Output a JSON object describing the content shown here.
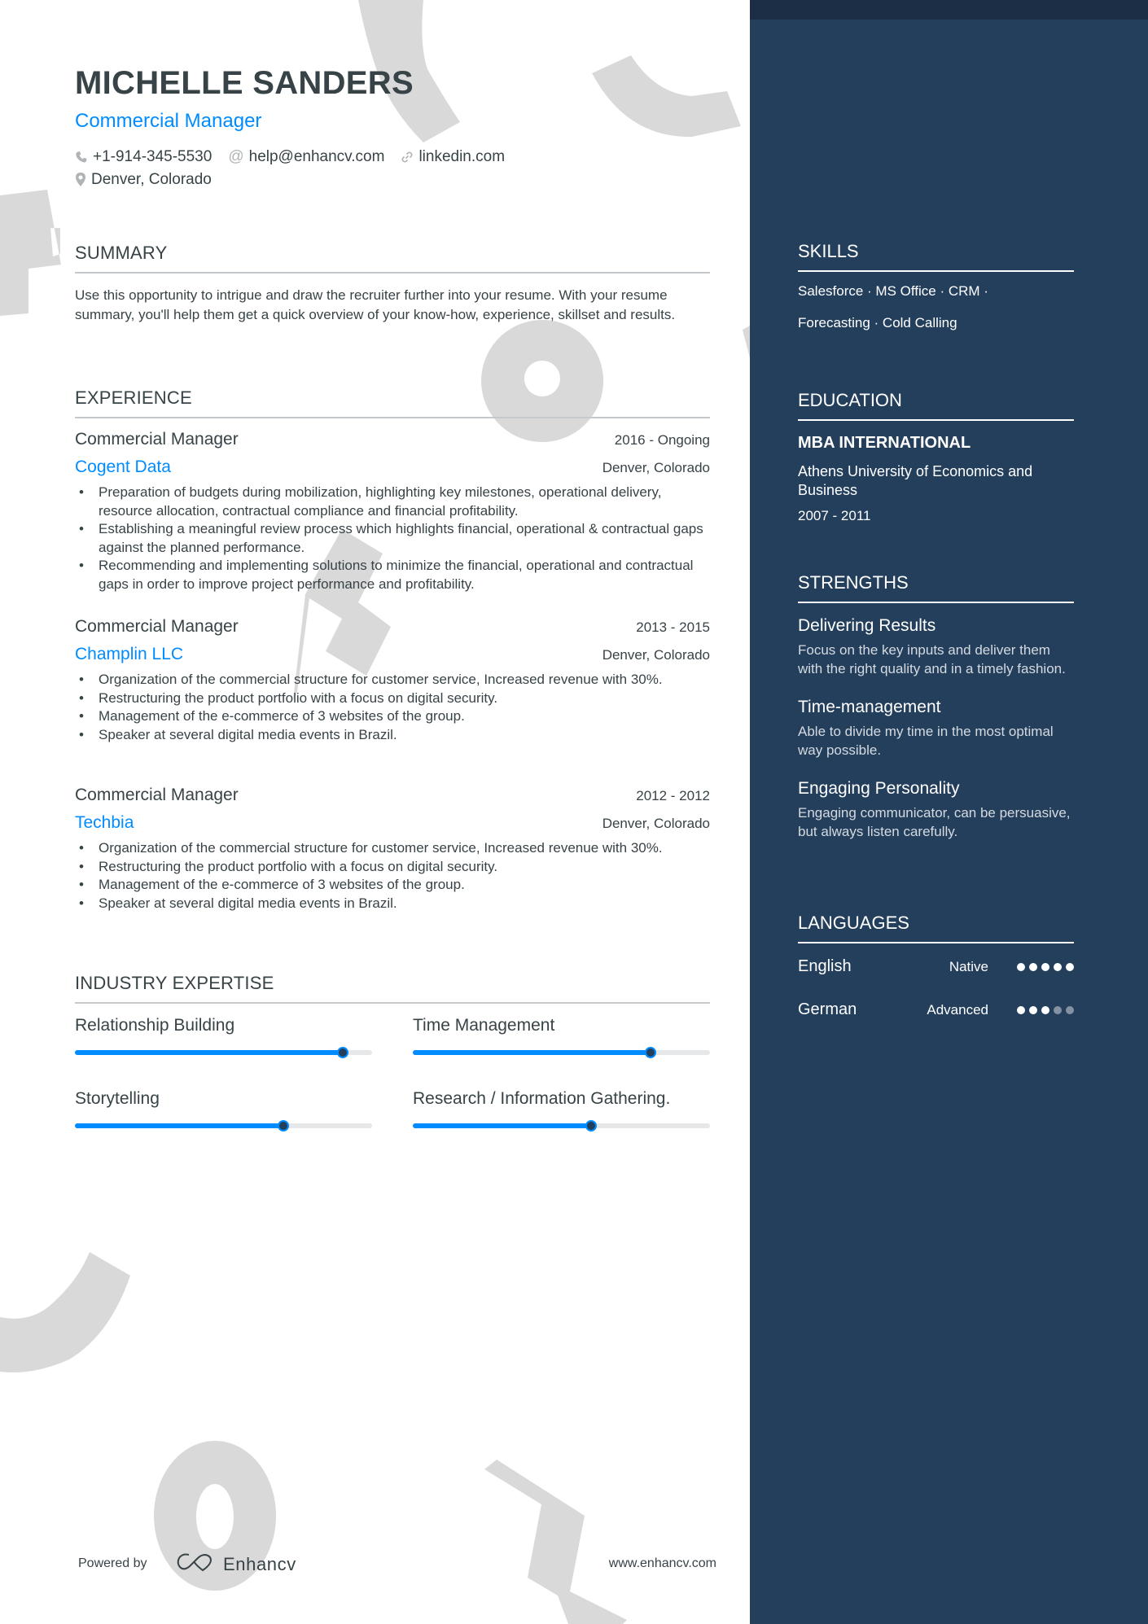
{
  "header": {
    "name": "MICHELLE SANDERS",
    "title": "Commercial Manager",
    "phone": "+1-914-345-5530",
    "email": "help@enhancv.com",
    "link": "linkedin.com",
    "location": "Denver, Colorado"
  },
  "summary": {
    "heading": "SUMMARY",
    "text": "Use this opportunity to intrigue and draw the recruiter further into your resume. With your resume summary, you'll help them get a quick overview of your know-how, experience, skillset and results."
  },
  "experience": {
    "heading": "EXPERIENCE",
    "jobs": [
      {
        "role": "Commercial Manager",
        "dates": "2016 - Ongoing",
        "company": "Cogent Data",
        "location": "Denver, Colorado",
        "bullets": [
          "Preparation of budgets during mobilization, highlighting key milestones, operational delivery, resource allocation, contractual compliance and financial profitability.",
          "Establishing a meaningful review process which highlights financial, operational & contractual gaps against the planned performance.",
          "Recommending and implementing solutions to minimize the financial, operational and contractual gaps in order to improve project performance and profitability."
        ]
      },
      {
        "role": "Commercial Manager",
        "dates": "2013 - 2015",
        "company": "Champlin LLC",
        "location": "Denver, Colorado",
        "bullets": [
          "Organization of the commercial structure for customer service, Increased revenue with 30%.",
          "Restructuring the product portfolio with a focus on digital security.",
          "Management of the e-commerce of 3 websites of the group.",
          "Speaker at several digital media events in Brazil."
        ]
      },
      {
        "role": "Commercial Manager",
        "dates": "2012 - 2012",
        "company": "Techbia",
        "location": "Denver, Colorado",
        "bullets": [
          "Organization of the commercial structure for customer service, Increased revenue with 30%.",
          "Restructuring the product portfolio with a focus on digital security.",
          "Management of the e-commerce of 3 websites of the group.",
          "Speaker at several digital media events in Brazil."
        ]
      }
    ]
  },
  "expertise": {
    "heading": "INDUSTRY EXPERTISE",
    "items": [
      {
        "label": "Relationship Building",
        "level": 0.9
      },
      {
        "label": "Time Management",
        "level": 0.8
      },
      {
        "label": "Storytelling",
        "level": 0.7
      },
      {
        "label": "Research / Information Gathering.",
        "level": 0.6
      }
    ]
  },
  "sidebar": {
    "skills": {
      "heading": "SKILLS",
      "lines": [
        "Salesforce · MS Office · CRM ·",
        "Forecasting · Cold Calling"
      ]
    },
    "education": {
      "heading": "EDUCATION",
      "degree": "MBA INTERNATIONAL",
      "school": "Athens University of Economics and Business",
      "dates": "2007 - 2011"
    },
    "strengths": {
      "heading": "STRENGTHS",
      "items": [
        {
          "title": "Delivering Results",
          "desc": "Focus on the key inputs and deliver them with the right quality and in a timely fashion."
        },
        {
          "title": "Time-management",
          "desc": "Able to divide my time in the most optimal way possible."
        },
        {
          "title": "Engaging Personality",
          "desc": "Engaging communicator, can be persuasive, but always listen carefully."
        }
      ]
    },
    "languages": {
      "heading": "LANGUAGES",
      "items": [
        {
          "name": "English",
          "level": "Native",
          "rating": 5,
          "max": 5
        },
        {
          "name": "German",
          "level": "Advanced",
          "rating": 3,
          "max": 5
        }
      ]
    }
  },
  "footer": {
    "powered_by": "Powered by",
    "brand": "Enhancv",
    "website": "www.enhancv.com"
  },
  "colors": {
    "accent": "#008cff",
    "sidebar": "#243f5c",
    "sidebar_band": "#1c2e45",
    "text": "#384347",
    "decoration": "#d9d9d9"
  }
}
